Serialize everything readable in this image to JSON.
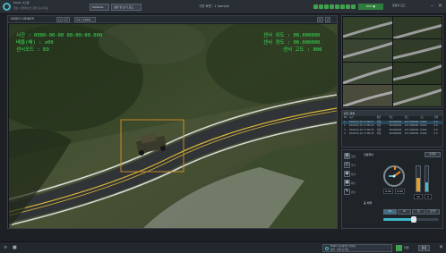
{
  "header": {
    "app_title": "EO/IR 시스템",
    "app_subtitle": "영상 시뮬레이션 재생 모니터링",
    "btn_mode": "MANUAL",
    "btn_config": "설정 및 보기 모드",
    "center_label": "기준 화면 : 1 Sample",
    "rec_label": "REC ●",
    "user_label": "운용자 모드"
  },
  "video_panel": {
    "title": "VIDEO VIEWER",
    "tool_zoom": "1:1 / 100%",
    "tool_a": "□",
    "tool_b": "▭",
    "tool_c": "↻",
    "tool_d": "⤢",
    "overlay": {
      "time": "시간 : 0000-00-00 00:00:00.000",
      "zoom": "배율(배) : x00",
      "sensor_mode": "센서모드 : EO",
      "lat": "센서 위도 : 00.000000",
      "lon": "센서 경도 : 00.000000",
      "alt": "센서 고도 : 000"
    }
  },
  "data_panel": {
    "title": "탐지 목록",
    "columns": [
      "No",
      "시간",
      "종류",
      "위도",
      "경도",
      "고도",
      "신뢰"
    ],
    "rows": [
      [
        "1",
        "2020-02-15 17:00:15",
        "차량",
        "36.000000",
        "127.000000",
        "0.000",
        "0.9"
      ],
      [
        "2",
        "2020-02-15 17:00:20",
        "차량",
        "36.000000",
        "127.000000",
        "0.000",
        "0.9"
      ],
      [
        "3",
        "2020-02-15 17:00:25",
        "차량",
        "36.000000",
        "127.000000",
        "0.000",
        "0.9"
      ],
      [
        "4",
        "2020-02-15 17:00:30",
        "차량",
        "36.000000",
        "127.000000",
        "0.000",
        "0.9"
      ]
    ]
  },
  "control_panel": {
    "side_buttons": [
      {
        "icon": "⚙",
        "label": "설정"
      },
      {
        "icon": "◎",
        "label": "추적"
      },
      {
        "icon": "◉",
        "label": "탐지"
      },
      {
        "icon": "▣",
        "label": "화면"
      },
      {
        "icon": "✎",
        "label": "편집"
      }
    ],
    "section_label": "짐벌제어",
    "button_reset": "초기화",
    "dial_value": "0.00",
    "dial_value2": "0.00",
    "gauge_value": "12",
    "gauge_value2": "0",
    "gauge_fill": 0.55,
    "gauge_fill2": 0.35,
    "tabs": [
      "EO",
      "IR",
      "줌",
      "포커스"
    ],
    "slider_label": "줌 배율",
    "slider_value": 0.55
  },
  "statusbar": {
    "info_line1": "EO/IR 시뮬레이터 연결됨",
    "info_line2": "상태 : 정상 동작중",
    "status_text": "연결",
    "btn_label": "종료"
  },
  "colors": {
    "accent": "#49b8c6",
    "overlay_text": "#39e05a",
    "track_box": "#d6902c"
  }
}
